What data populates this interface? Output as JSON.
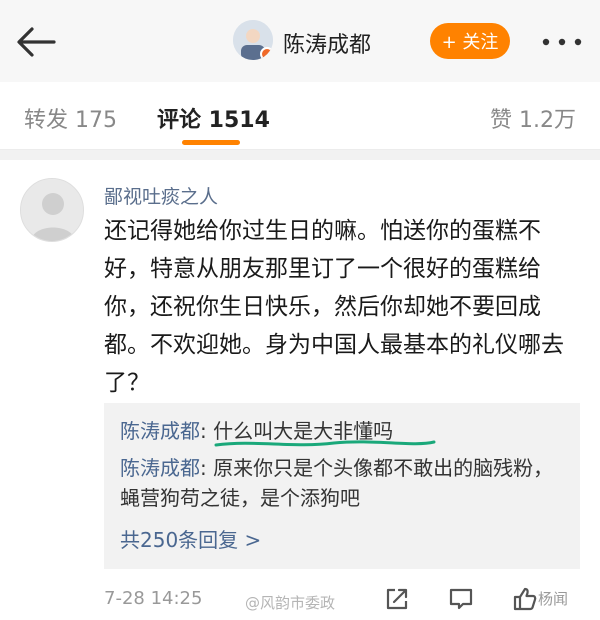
{
  "header": {
    "author_name": "陈涛成都",
    "follow_label": "+ 关注",
    "back_icon": "back-arrow-icon",
    "more_icon": "more-dots-icon"
  },
  "tabs": {
    "repost_label": "转发 175",
    "comments_label": "评论 1514",
    "likes_label": "赞 1.2万",
    "active": "comments",
    "accent_color": "#ff8200"
  },
  "comment": {
    "username": "鄙视吐痰之人",
    "text": "还记得她给你过生日的嘛。怕送你的蛋糕不好，特意从朋友那里订了一个很好的蛋糕给你，还祝你生日快乐，然后你却她不要回成都。不欢迎她。身为中国人最基本的礼仪哪去了？",
    "time": "7-28 14:25"
  },
  "replies": [
    {
      "user": "陈涛成都",
      "separator": ": ",
      "text": "什么叫大是大非懂吗"
    },
    {
      "user": "陈涛成都",
      "separator": ": ",
      "text": "原来你只是个头像都不敢出的脑残粉，蝇营狗苟之徒，是个添狗吧"
    }
  ],
  "replies_more": "共250条回复 >",
  "watermark": "@风韵市委政",
  "footer_brand": "杨闻",
  "icons": {
    "share": "share-icon",
    "comment": "comment-icon",
    "like": "like-icon"
  },
  "colors": {
    "link_blue": "#4a6790",
    "highlight_line": "#1aa87a"
  }
}
